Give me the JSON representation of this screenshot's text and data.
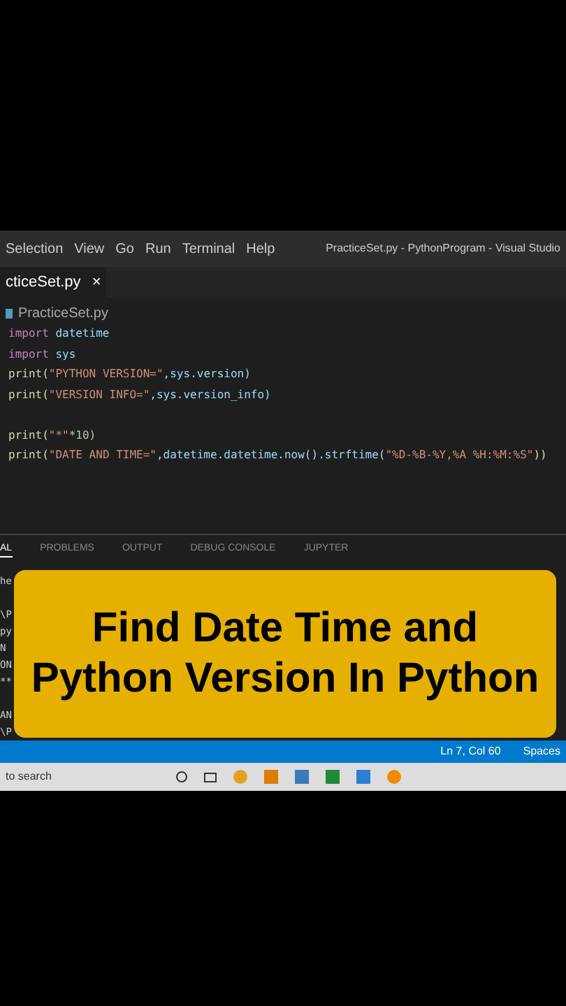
{
  "menu": [
    "Selection",
    "View",
    "Go",
    "Run",
    "Terminal",
    "Help"
  ],
  "window": {
    "title": "PracticeSet.py - PythonProgram - Visual Studio"
  },
  "tab": {
    "label": "cticeSet.py",
    "close": "×"
  },
  "breadcrumb": "PracticeSet.py",
  "code": [
    {
      "gap_before": false,
      "segments": [
        {
          "t": "import ",
          "kind": "kw"
        },
        {
          "t": "datetime",
          "kind": "mod"
        }
      ]
    },
    {
      "gap_before": false,
      "segments": [
        {
          "t": "import ",
          "kind": "kw"
        },
        {
          "t": "sys",
          "kind": "mod"
        }
      ]
    },
    {
      "gap_before": false,
      "segments": [
        {
          "t": "print(",
          "kind": "fn"
        },
        {
          "t": "\"PYTHON VERSION=\"",
          "kind": "str"
        },
        {
          "t": ",sys.version)",
          "kind": "mod"
        }
      ]
    },
    {
      "gap_before": false,
      "segments": [
        {
          "t": "print(",
          "kind": "fn"
        },
        {
          "t": "\"VERSION INFO=\"",
          "kind": "str"
        },
        {
          "t": ",sys.version_info)",
          "kind": "mod"
        }
      ]
    },
    {
      "gap_before": true,
      "segments": [
        {
          "t": "print(",
          "kind": "fn"
        },
        {
          "t": "\"*\"",
          "kind": "str"
        },
        {
          "t": "*10)",
          "kind": "num"
        }
      ]
    },
    {
      "gap_before": false,
      "segments": [
        {
          "t": "print(",
          "kind": "fn"
        },
        {
          "t": "\"DATE AND TIME=\"",
          "kind": "str"
        },
        {
          "t": ",datetime.datetime.now().strftime(",
          "kind": "mod"
        },
        {
          "t": "\"%D-%B-%Y,%A %H:%M:%S\"",
          "kind": "str"
        },
        {
          "t": "))",
          "kind": "fn"
        }
      ]
    }
  ],
  "panel_tabs": [
    {
      "label": "AL",
      "selected": true
    },
    {
      "label": "PROBLEMS",
      "selected": false
    },
    {
      "label": "OUTPUT",
      "selected": false
    },
    {
      "label": "DEBUG CONSOLE",
      "selected": false
    },
    {
      "label": "JUPYTER",
      "selected": false
    }
  ],
  "terminal": [
    {
      "text": "he",
      "gap_before": false
    },
    {
      "text": "\\P",
      "gap_before": true
    },
    {
      "text": "py",
      "gap_before": false
    },
    {
      "text": "N",
      "gap_before": false
    },
    {
      "text": "ON",
      "gap_before": false
    },
    {
      "text": "**",
      "gap_before": false
    },
    {
      "text": "AN",
      "gap_before": true
    },
    {
      "text": "\\P",
      "gap_before": false
    }
  ],
  "status_bar": {
    "position": "Ln 7, Col 60",
    "spaces": "Spaces"
  },
  "taskbar": {
    "search": "to search"
  },
  "overlay": {
    "title": "Find Date Time and Python Version In Python"
  }
}
